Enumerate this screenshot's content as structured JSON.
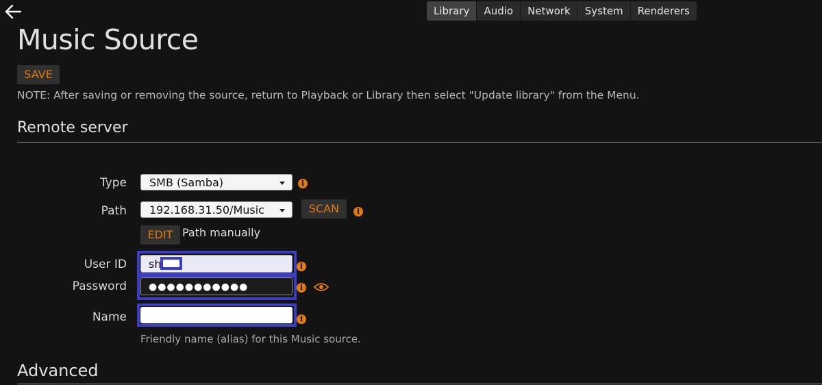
{
  "header": {
    "back_icon": "arrow-left-icon",
    "tabs": [
      {
        "label": "Library",
        "active": true
      },
      {
        "label": "Audio",
        "active": false
      },
      {
        "label": "Network",
        "active": false
      },
      {
        "label": "System",
        "active": false
      },
      {
        "label": "Renderers",
        "active": false
      }
    ]
  },
  "page": {
    "title": "Music Source",
    "save_label": "SAVE",
    "note": "NOTE: After saving or removing the source, return to Playback or Library then select \"Update library\" from the Menu."
  },
  "remote_server": {
    "title": "Remote server",
    "type": {
      "label": "Type",
      "value": "SMB (Samba)"
    },
    "path": {
      "label": "Path",
      "value": "192.168.31.50/Music",
      "scan_label": "SCAN"
    },
    "edit": {
      "button_label": "EDIT",
      "text": "Path manually"
    },
    "user_id": {
      "label": "User ID",
      "value": "sh"
    },
    "password": {
      "label": "Password",
      "value": "●●●●●●●●●●●"
    },
    "name": {
      "label": "Name",
      "value": "",
      "help": "Friendly name (alias) for this Music source."
    },
    "info_icon": "info-icon",
    "eye_icon": "eye-icon"
  },
  "advanced": {
    "title": "Advanced"
  },
  "colors": {
    "background": "#131313",
    "accent": "#e07a12",
    "highlight_frame": "#3b3ec2"
  }
}
